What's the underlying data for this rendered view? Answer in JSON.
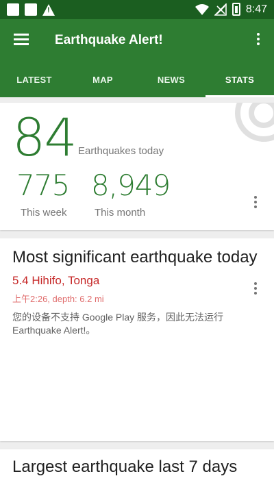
{
  "status": {
    "time": "8:47"
  },
  "appbar": {
    "title": "Earthquake Alert!"
  },
  "tabs": [
    {
      "label": "LATEST"
    },
    {
      "label": "MAP"
    },
    {
      "label": "NEWS"
    },
    {
      "label": "STATS",
      "active": true
    }
  ],
  "stats": {
    "today_count": "84",
    "today_label": "Earthquakes today",
    "week_count": "775",
    "week_label": "This week",
    "month_count": "8,949",
    "month_label": "This month"
  },
  "significant": {
    "title": "Most significant earthquake today",
    "location": "5.4 Hihifo, Tonga",
    "meta": "上午2:26, depth: 6.2 mi",
    "notice": "您的设备不支持 Google Play 服务，因此无法运行 Earthquake Alert!。"
  },
  "largest": {
    "title": "Largest earthquake last 7 days"
  },
  "colors": {
    "primary_dark": "#1b5e20",
    "primary": "#2e7d32",
    "accent_red": "#c62828"
  },
  "icons": [
    "menu-icon",
    "more-vert-icon",
    "wifi-icon",
    "signal-icon",
    "battery-icon",
    "warning-icon",
    "radar-icon"
  ]
}
